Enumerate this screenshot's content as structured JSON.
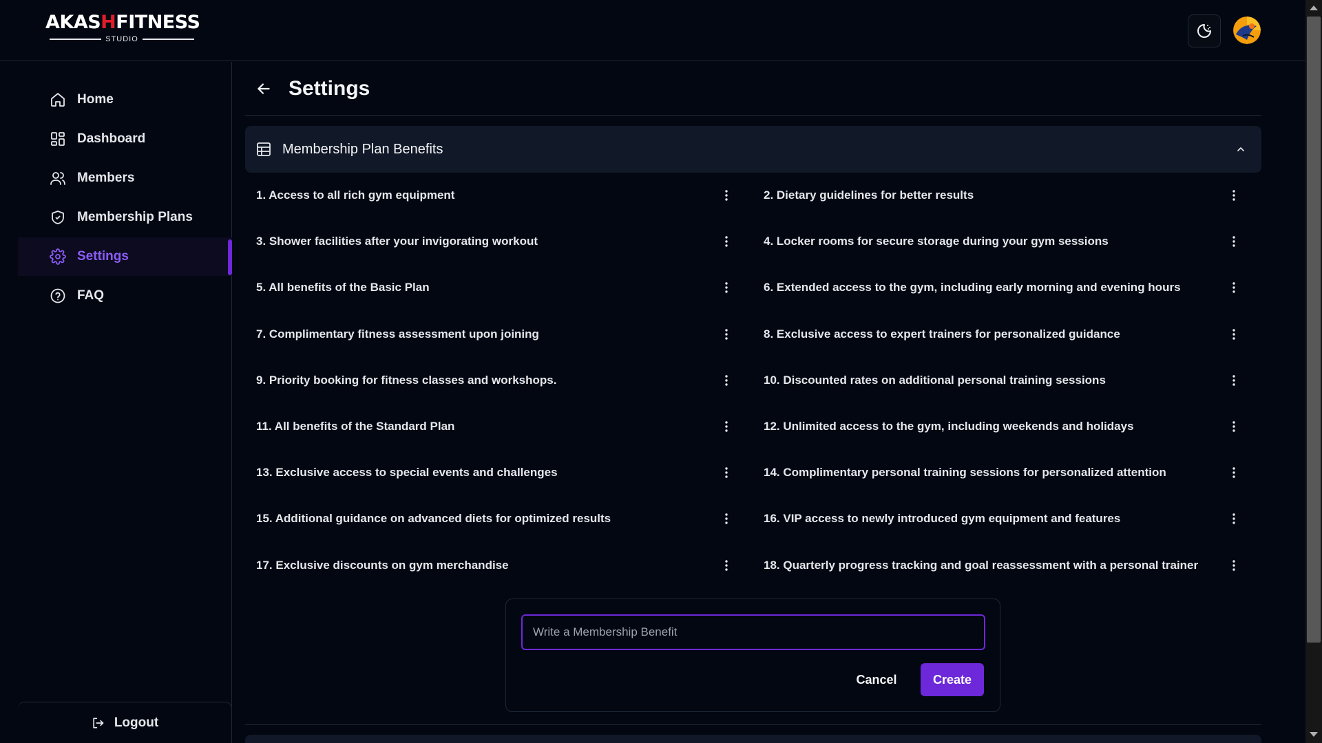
{
  "app": {
    "logo_main_left": "AKAS",
    "logo_mark": "H",
    "logo_main_right": "FITNESS",
    "logo_sub": "STUDIO"
  },
  "header": {
    "theme_toggle_icon": "moon-icon",
    "avatar_icon": "user-avatar"
  },
  "sidebar": {
    "items": [
      {
        "label": "Home",
        "icon": "home-icon"
      },
      {
        "label": "Dashboard",
        "icon": "dashboard-icon"
      },
      {
        "label": "Members",
        "icon": "users-icon"
      },
      {
        "label": "Membership Plans",
        "icon": "shield-icon"
      },
      {
        "label": "Settings",
        "icon": "gear-icon",
        "active": true
      },
      {
        "label": "FAQ",
        "icon": "help-icon"
      }
    ],
    "logout_label": "Logout"
  },
  "page": {
    "title": "Settings"
  },
  "section": {
    "title": "Membership Plan Benefits",
    "expanded": true
  },
  "benefits": [
    "1. Access to all rich gym equipment",
    "2. Dietary guidelines for better results",
    "3. Shower facilities after your invigorating workout",
    "4. Locker rooms for secure storage during your gym sessions",
    "5. All benefits of the Basic Plan",
    "6. Extended access to the gym, including early morning and evening hours",
    "7. Complimentary fitness assessment upon joining",
    "8. Exclusive access to expert trainers for personalized guidance",
    "9. Priority booking for fitness classes and workshops.",
    "10. Discounted rates on additional personal training sessions",
    "11. All benefits of the Standard Plan",
    "12. Unlimited access to the gym, including weekends and holidays",
    "13. Exclusive access to special events and challenges",
    "14. Complimentary personal training sessions for personalized attention",
    "15. Additional guidance on advanced diets for optimized results",
    "16. VIP access to newly introduced gym equipment and features",
    "17. Exclusive discounts on gym merchandise",
    "18. Quarterly progress tracking and goal reassessment with a personal trainer"
  ],
  "form": {
    "placeholder": "Write a Membership Benefit",
    "value": "",
    "cancel_label": "Cancel",
    "create_label": "Create"
  },
  "colors": {
    "accent": "#6d28d9",
    "active_text": "#8b5cf6",
    "background": "#030712",
    "card": "#111827",
    "logo_red": "#e11d2a"
  }
}
